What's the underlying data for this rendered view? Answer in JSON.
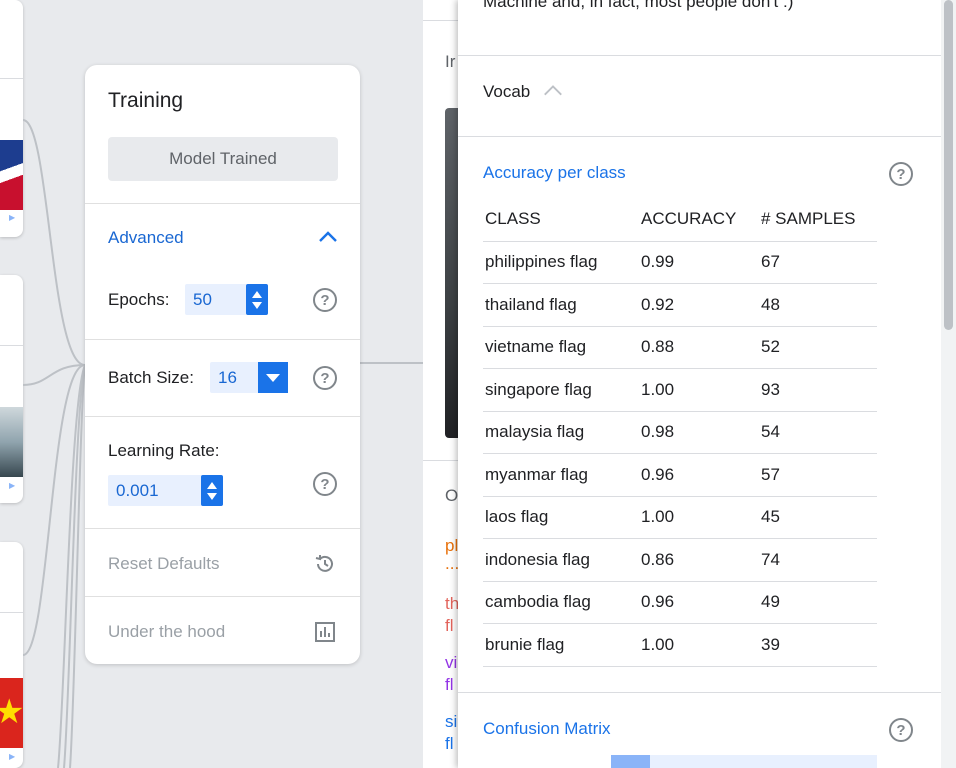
{
  "training": {
    "title": "Training",
    "status_button": "Model Trained",
    "advanced_label": "Advanced",
    "epochs_label": "Epochs:",
    "epochs_value": "50",
    "batch_label": "Batch Size:",
    "batch_value": "16",
    "lr_label": "Learning Rate:",
    "lr_value": "0.001",
    "reset_label": "Reset Defaults",
    "hood_label": "Under the hood"
  },
  "middle": {
    "frag_top": "Ir",
    "frag_mid": "O",
    "frag_1a": "pl",
    "frag_1b": "...",
    "frag_2a": "th",
    "frag_2b": "fl",
    "frag_3a": "vi",
    "frag_3b": "fl",
    "frag_4a": "si",
    "frag_4b": "fl"
  },
  "panel": {
    "top_text": "Machine and, in fact, most people don't :)",
    "vocab_label": "Vocab",
    "accuracy_title": "Accuracy per class",
    "columns": [
      "CLASS",
      "ACCURACY",
      "# SAMPLES"
    ],
    "rows": [
      [
        "philippines flag",
        "0.99",
        "67"
      ],
      [
        "thailand flag",
        "0.92",
        "48"
      ],
      [
        "vietname flag",
        "0.88",
        "52"
      ],
      [
        "singapore flag",
        "1.00",
        "93"
      ],
      [
        "malaysia flag",
        "0.98",
        "54"
      ],
      [
        "myanmar flag",
        "0.96",
        "57"
      ],
      [
        "laos flag",
        "1.00",
        "45"
      ],
      [
        "indonesia flag",
        "0.86",
        "74"
      ],
      [
        "cambodia flag",
        "0.96",
        "49"
      ],
      [
        "brunie flag",
        "1.00",
        "39"
      ]
    ],
    "confusion_title": "Confusion Matrix"
  },
  "icons": {
    "help": "help-circle-icon",
    "history": "history-icon",
    "chart": "bar-chart-icon"
  },
  "colors": {
    "accent": "#1a73e8",
    "text": "#202124",
    "muted": "#9aa0a6"
  }
}
